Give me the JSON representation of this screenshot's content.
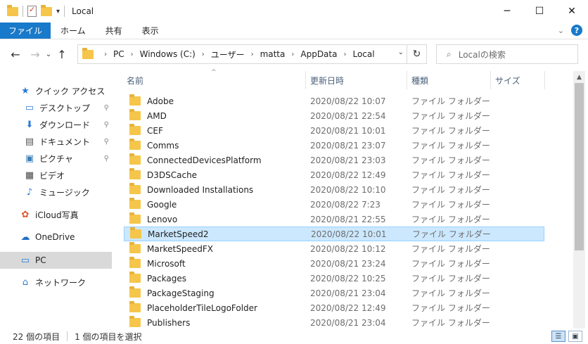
{
  "window": {
    "title": "Local",
    "controls": {
      "minimize": "─",
      "maximize": "☐",
      "close": "✕"
    }
  },
  "ribbon": {
    "tabs": [
      "ファイル",
      "ホーム",
      "共有",
      "表示"
    ],
    "expand": "⌄",
    "help": "?"
  },
  "nav": {
    "back": "←",
    "forward": "→",
    "recent": "⌄",
    "up": "↑",
    "path": [
      "PC",
      "Windows (C:)",
      "ユーザー",
      "matta",
      "AppData",
      "Local"
    ],
    "refresh": "↻",
    "search_placeholder": "Localの検索"
  },
  "sidebar": {
    "items": [
      {
        "label": "クイック アクセス",
        "icon": "star-icon"
      },
      {
        "label": "デスクトップ",
        "icon": "desktop-icon",
        "pinned": true
      },
      {
        "label": "ダウンロード",
        "icon": "download-icon",
        "pinned": true
      },
      {
        "label": "ドキュメント",
        "icon": "document-icon",
        "pinned": true
      },
      {
        "label": "ピクチャ",
        "icon": "pictures-icon",
        "pinned": true
      },
      {
        "label": "ビデオ",
        "icon": "video-icon"
      },
      {
        "label": "ミュージック",
        "icon": "music-icon"
      },
      {
        "label": "iCloud写真",
        "icon": "icloud-photos-icon"
      },
      {
        "label": "OneDrive",
        "icon": "onedrive-icon"
      },
      {
        "label": "PC",
        "icon": "pc-icon",
        "selected": true
      },
      {
        "label": "ネットワーク",
        "icon": "network-icon"
      }
    ]
  },
  "columns": {
    "name": "名前",
    "date": "更新日時",
    "type": "種類",
    "size": "サイズ"
  },
  "files": [
    {
      "name": "Adobe",
      "date": "2020/08/22 10:07",
      "type": "ファイル フォルダー"
    },
    {
      "name": "AMD",
      "date": "2020/08/21 22:54",
      "type": "ファイル フォルダー"
    },
    {
      "name": "CEF",
      "date": "2020/08/21 10:01",
      "type": "ファイル フォルダー"
    },
    {
      "name": "Comms",
      "date": "2020/08/21 23:07",
      "type": "ファイル フォルダー"
    },
    {
      "name": "ConnectedDevicesPlatform",
      "date": "2020/08/21 23:03",
      "type": "ファイル フォルダー"
    },
    {
      "name": "D3DSCache",
      "date": "2020/08/22 12:49",
      "type": "ファイル フォルダー"
    },
    {
      "name": "Downloaded Installations",
      "date": "2020/08/22 10:10",
      "type": "ファイル フォルダー"
    },
    {
      "name": "Google",
      "date": "2020/08/22 7:23",
      "type": "ファイル フォルダー"
    },
    {
      "name": "Lenovo",
      "date": "2020/08/21 22:55",
      "type": "ファイル フォルダー"
    },
    {
      "name": "MarketSpeed2",
      "date": "2020/08/22 10:01",
      "type": "ファイル フォルダー",
      "selected": true
    },
    {
      "name": "MarketSpeedFX",
      "date": "2020/08/22 10:12",
      "type": "ファイル フォルダー"
    },
    {
      "name": "Microsoft",
      "date": "2020/08/21 23:24",
      "type": "ファイル フォルダー"
    },
    {
      "name": "Packages",
      "date": "2020/08/22 10:25",
      "type": "ファイル フォルダー"
    },
    {
      "name": "PackageStaging",
      "date": "2020/08/21 23:04",
      "type": "ファイル フォルダー"
    },
    {
      "name": "PlaceholderTileLogoFolder",
      "date": "2020/08/22 12:49",
      "type": "ファイル フォルダー"
    },
    {
      "name": "Publishers",
      "date": "2020/08/21 23:04",
      "type": "ファイル フォルダー"
    }
  ],
  "status": {
    "item_count": "22 個の項目",
    "selected": "1 個の項目を選択"
  },
  "colors": {
    "file_tab": "#1979ca",
    "selection": "#cce8ff",
    "folder": "#f5c64a"
  }
}
